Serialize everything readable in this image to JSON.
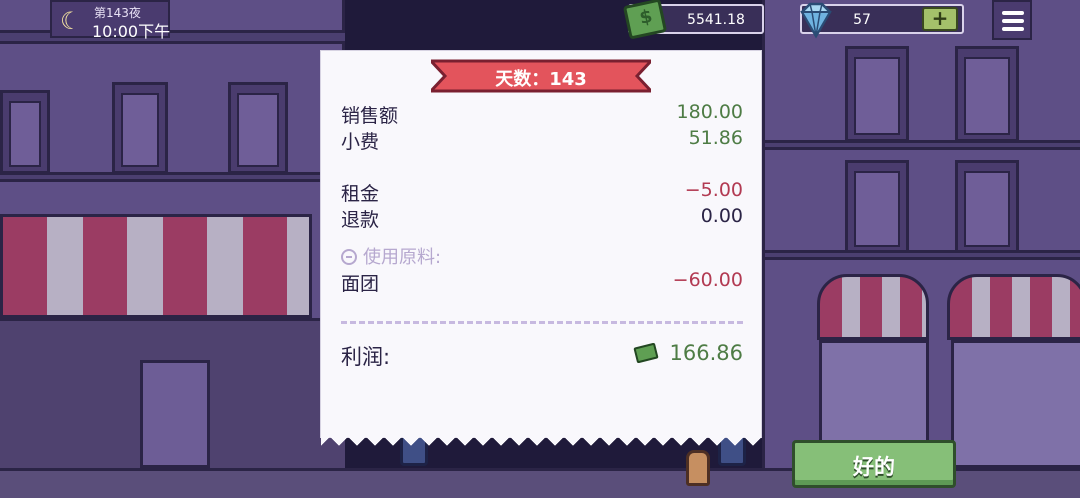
{
  "hud": {
    "night_label": "第143夜",
    "time_label": "10:00下午",
    "money": "5541.18",
    "gems": "57",
    "plus_label": "+"
  },
  "receipt": {
    "banner_label": "天数：143",
    "rows": [
      {
        "label": "销售额",
        "value": "180.00"
      },
      {
        "label": "小费",
        "value": "51.86"
      },
      {
        "label": "租金",
        "value": "−5.00"
      },
      {
        "label": "退款",
        "value": "0.00"
      }
    ],
    "section_label": "使用原料:",
    "ingredients": [
      {
        "label": "面团",
        "value": "−60.00"
      }
    ],
    "profit_label": "利润:",
    "profit_value": "166.86"
  },
  "ok_label": "好的",
  "colors": {
    "positive": "#4e7c45",
    "negative": "#b23a52",
    "banner": "#e3545c"
  }
}
